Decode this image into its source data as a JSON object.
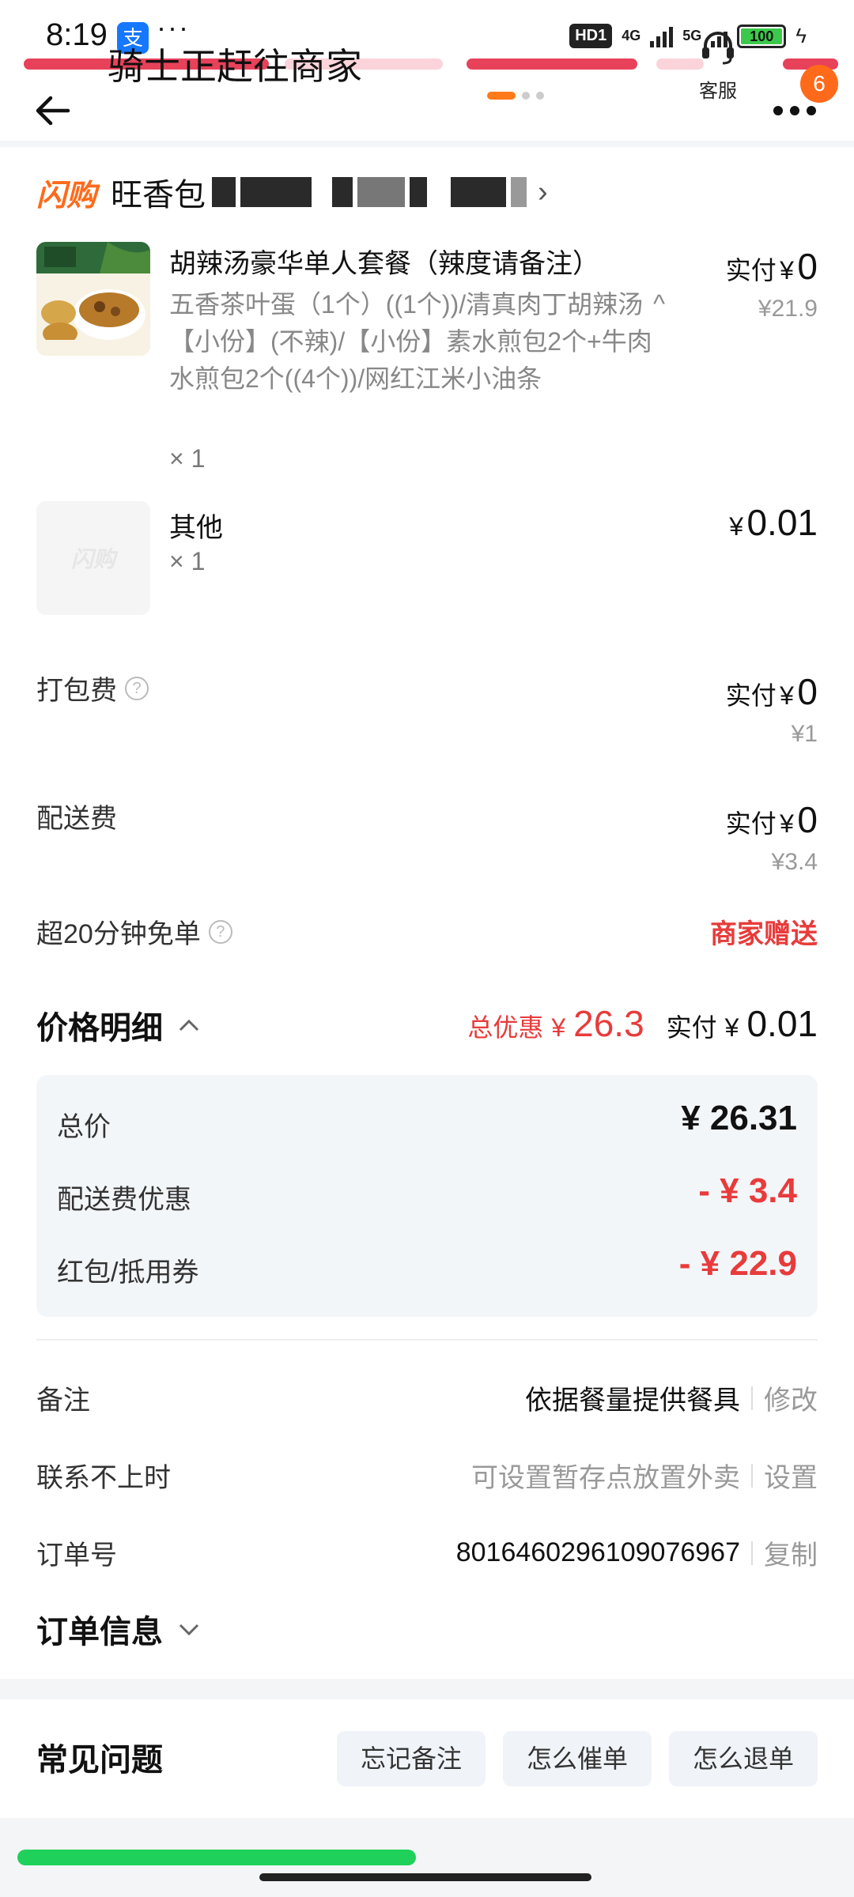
{
  "status_bar": {
    "time": "8:19",
    "app_icon": "支",
    "dots": "···",
    "hd": "HD1",
    "net1": "4G",
    "net2": "5G",
    "battery": "100"
  },
  "header": {
    "rider_status": "骑士正赶往商家",
    "service_label": "客服",
    "badge_count": "6"
  },
  "shop": {
    "tag": "闪购",
    "name": "旺香包",
    "chevron": "›"
  },
  "items": [
    {
      "title": "胡辣汤豪华单人套餐（辣度请备注）",
      "desc": "五香茶叶蛋（1个）((1个))/清真肉丁胡辣汤【小份】(不辣)/【小份】素水煎包2个+牛肉水煎包2个((4个))/网红江米小油条",
      "qty": "× 1",
      "paid_label": "实付",
      "yen": "¥",
      "paid": "0",
      "original": "¥21.9"
    },
    {
      "title": "其他",
      "qty": "× 1",
      "placeholder": "闪购",
      "yen": "¥",
      "price": "0.01"
    }
  ],
  "fees": {
    "packing": {
      "label": "打包费",
      "paid_label": "实付",
      "yen": "¥",
      "paid": "0",
      "original": "¥1"
    },
    "delivery": {
      "label": "配送费",
      "paid_label": "实付",
      "yen": "¥",
      "paid": "0",
      "original": "¥3.4"
    },
    "free_order": {
      "label": "超20分钟免单",
      "value": "商家赠送"
    }
  },
  "price_detail": {
    "title": "价格明细",
    "discount_label": "总优惠",
    "yen": "¥",
    "discount": "26.3",
    "paid_label": "实付",
    "paid": "0.01",
    "lines": [
      {
        "label": "总价",
        "value": "¥ 26.31"
      },
      {
        "label": "配送费优惠",
        "value": "- ¥ 3.4"
      },
      {
        "label": "红包/抵用券",
        "value": "- ¥ 22.9"
      }
    ]
  },
  "info": {
    "remark": {
      "label": "备注",
      "value": "依据餐量提供餐具",
      "action": "修改"
    },
    "unreachable": {
      "label": "联系不上时",
      "value": "可设置暂存点放置外卖",
      "action": "设置"
    },
    "order_no": {
      "label": "订单号",
      "value": "8016460296109076967",
      "action": "复制"
    },
    "order_info_title": "订单信息"
  },
  "faq": {
    "title": "常见问题",
    "chips": [
      "忘记备注",
      "怎么催单",
      "怎么退单"
    ]
  },
  "colors": {
    "accent_orange": "#ff6a1a",
    "price_red": "#e83b3b",
    "progress_green": "#1fd15a",
    "panel_bg": "#f3f6f9"
  }
}
